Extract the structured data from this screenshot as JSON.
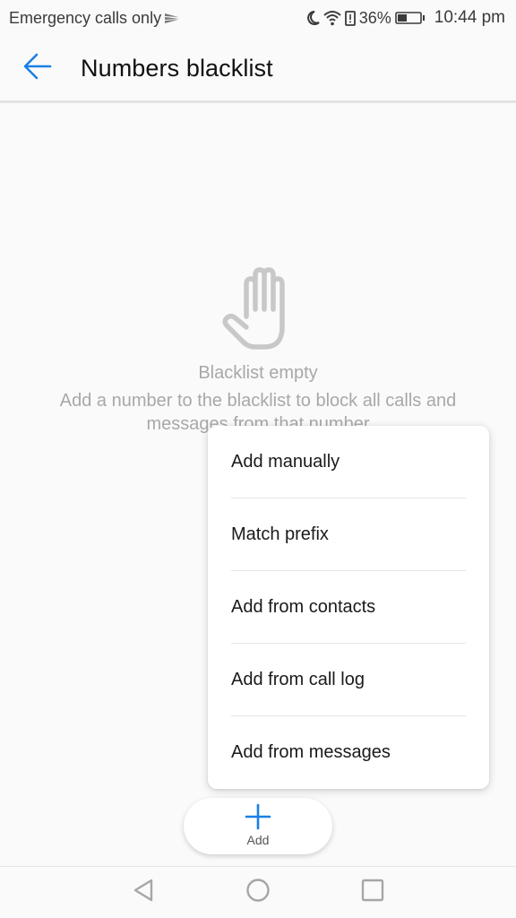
{
  "status_bar": {
    "carrier_text": "Emergency calls only",
    "battery_percent": "36%",
    "time": "10:44 pm",
    "icons": [
      "swift-key-icon",
      "moon-icon",
      "wifi-icon",
      "battery-alert-icon",
      "battery-icon"
    ]
  },
  "app_bar": {
    "title": "Numbers blacklist",
    "back_icon": "arrow-left-icon",
    "accent_color": "#1a7fe6"
  },
  "empty_state": {
    "icon": "hand-stop-icon",
    "title": "Blacklist empty",
    "description": "Add a number to the blacklist to block all calls and messages from that number"
  },
  "popup_menu": {
    "items": [
      {
        "label": "Add manually"
      },
      {
        "label": "Match prefix"
      },
      {
        "label": "Add from contacts"
      },
      {
        "label": "Add from call log"
      },
      {
        "label": "Add from messages"
      }
    ]
  },
  "add_button": {
    "label": "Add",
    "icon": "plus-icon"
  },
  "nav_bar": {
    "back": "nav-back-icon",
    "home": "nav-home-icon",
    "recent": "nav-recent-icon"
  }
}
